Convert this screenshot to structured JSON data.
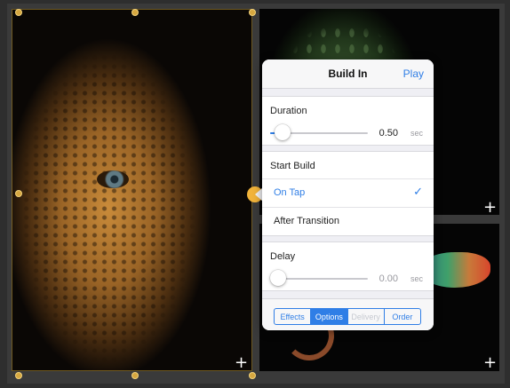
{
  "popover": {
    "title": "Build In",
    "play_label": "Play",
    "duration": {
      "label": "Duration",
      "value": "0.50",
      "unit": "sec",
      "fraction": 0.09
    },
    "start_build": {
      "label": "Start Build",
      "options": [
        "On Tap",
        "After Transition"
      ],
      "selected": "On Tap",
      "check_glyph": "✓"
    },
    "delay": {
      "label": "Delay",
      "value": "0.00",
      "unit": "sec",
      "fraction": 0.0
    },
    "tabs": [
      {
        "label": "Effects",
        "state": "normal"
      },
      {
        "label": "Options",
        "state": "active"
      },
      {
        "label": "Delivery",
        "state": "disabled"
      },
      {
        "label": "Order",
        "state": "normal"
      }
    ]
  },
  "photos": {
    "add_glyph": "+"
  },
  "colors": {
    "accent": "#2f7ee6",
    "selection_handle": "#d6a740",
    "background": "#2e2e2e"
  },
  "icons": {
    "add": "plus-icon",
    "checkmark": "checkmark-icon"
  }
}
